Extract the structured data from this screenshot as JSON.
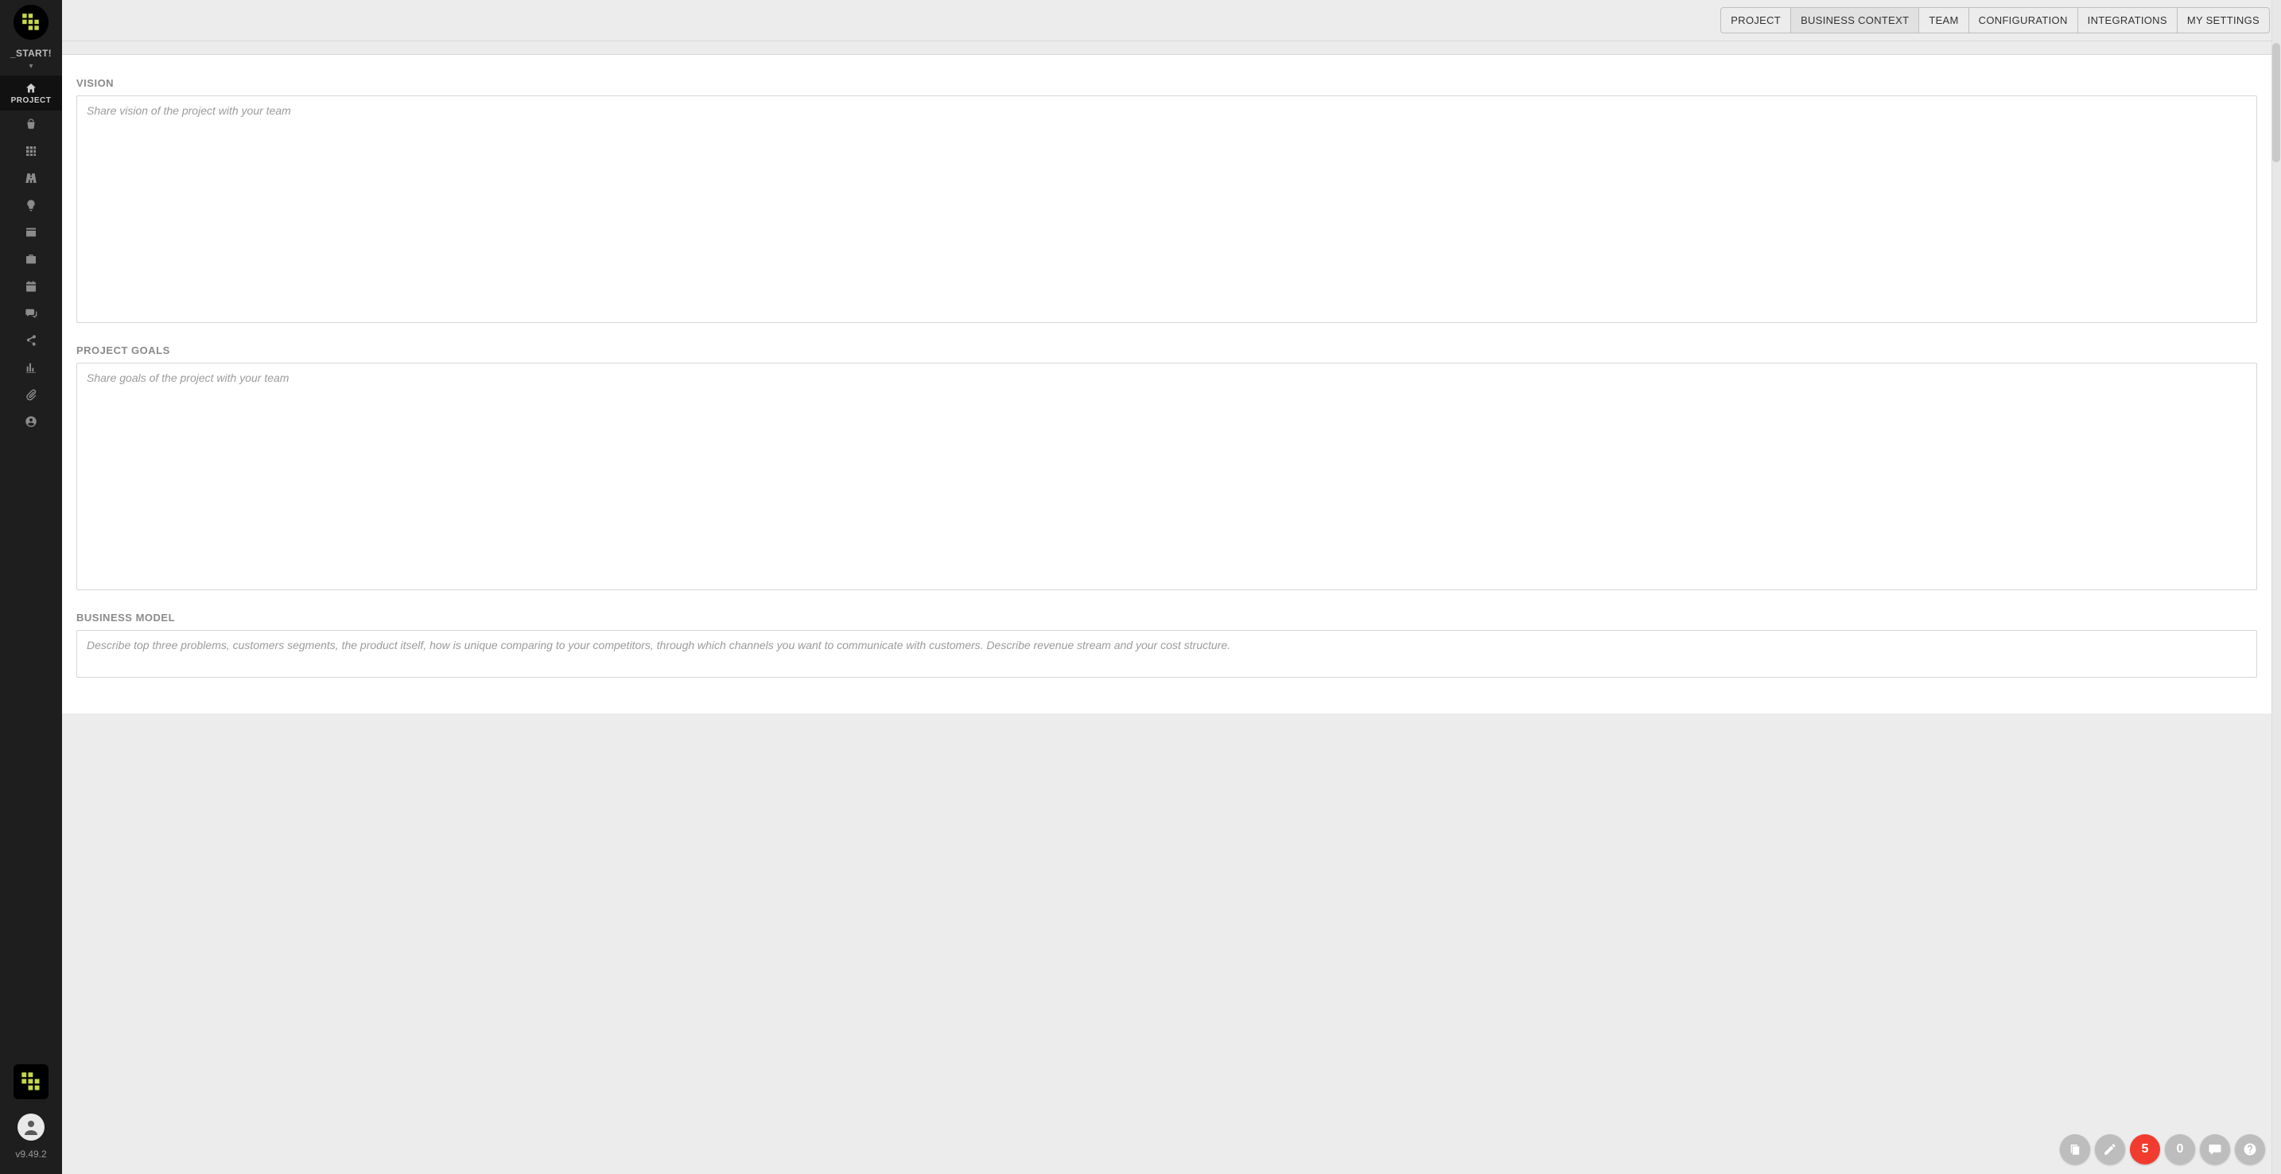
{
  "sidebar": {
    "project_title": "_START!",
    "active_label": "PROJECT",
    "version": "v9.49.2"
  },
  "header": {
    "tabs": [
      {
        "label": "PROJECT",
        "active": false
      },
      {
        "label": "BUSINESS CONTEXT",
        "active": true
      },
      {
        "label": "TEAM",
        "active": false
      },
      {
        "label": "CONFIGURATION",
        "active": false
      },
      {
        "label": "INTEGRATIONS",
        "active": false
      },
      {
        "label": "MY SETTINGS",
        "active": false
      }
    ]
  },
  "sections": {
    "vision": {
      "label": "VISION",
      "placeholder": "Share vision of the project with your team",
      "value": ""
    },
    "project_goals": {
      "label": "PROJECT GOALS",
      "placeholder": "Share goals of the project with your team",
      "value": ""
    },
    "business_model": {
      "label": "BUSINESS MODEL",
      "placeholder": "Describe top three problems, customers segments, the product itself, how is unique comparing to your competitors, through which channels you want to communicate with customers. Describe revenue stream and your cost structure.",
      "value": ""
    }
  },
  "float": {
    "badge_red": "5",
    "badge_grey": "0"
  }
}
